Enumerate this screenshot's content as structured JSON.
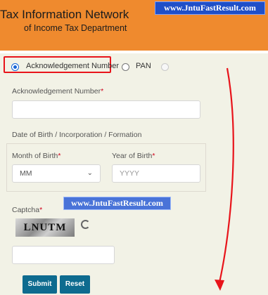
{
  "header": {
    "title": "Tax Information Network",
    "subtitle": "of Income Tax Department"
  },
  "watermark": {
    "text_top": "www.JntuFastResult.com",
    "text_middle": "www.JntuFastResult.com"
  },
  "search_type": {
    "options": [
      {
        "label": "Acknowledgement Number",
        "selected": true
      },
      {
        "label": "PAN",
        "selected": false
      }
    ]
  },
  "form": {
    "ack_label": "Acknowledgement Number",
    "ack_value": "",
    "dob_label": "Date of Birth / Incorporation / Formation",
    "month_label": "Month of Birth",
    "month_value": "MM",
    "year_label": "Year of Birth",
    "year_placeholder": "YYYY",
    "captcha_label": "Captcha",
    "captcha_text": "LNUTM",
    "captcha_value": "",
    "required_mark": "*"
  },
  "buttons": {
    "submit": "Submit",
    "reset": "Reset"
  },
  "colors": {
    "header_bg": "#ef8a2e",
    "panel_bg": "#f2f2e6",
    "button_bg": "#0e6b8f",
    "highlight": "#e8141b"
  }
}
